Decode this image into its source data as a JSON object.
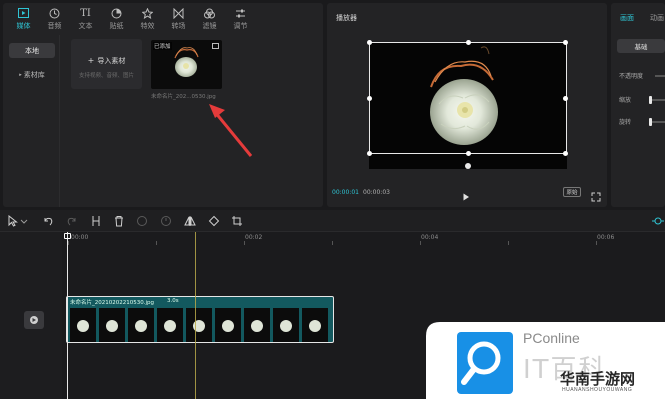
{
  "media_panel": {
    "tabs": [
      {
        "label": "媒体",
        "icon": "media-icon"
      },
      {
        "label": "音频",
        "icon": "audio-icon"
      },
      {
        "label": "文本",
        "icon": "text-icon"
      },
      {
        "label": "贴纸",
        "icon": "sticker-icon"
      },
      {
        "label": "特效",
        "icon": "effects-icon"
      },
      {
        "label": "转场",
        "icon": "transition-icon"
      },
      {
        "label": "滤镜",
        "icon": "filter-icon"
      },
      {
        "label": "调节",
        "icon": "adjust-icon"
      }
    ],
    "side": {
      "local": "本地",
      "library": "素材库"
    },
    "import": {
      "label": "导入素材",
      "hint": "支持视频、音频、图片"
    },
    "item": {
      "tag": "已添加",
      "filename": "未命名片_202...0530.jpg"
    }
  },
  "player": {
    "title": "播放器",
    "time_current": "00:00:01",
    "time_total": "00:00:03",
    "ratio": "原始"
  },
  "props": {
    "tab_screen": "画面",
    "tab_anim": "动画",
    "basic": "基础",
    "opacity": "不透明度",
    "scale": "缩放",
    "rotate": "旋转"
  },
  "timeline": {
    "ruler": [
      "00:00",
      "00:02",
      "00:04",
      "00:06"
    ],
    "clip": {
      "name": "未命名片_20210202210530.jpg",
      "duration": "3.0s"
    }
  },
  "watermark": {
    "brand": "PConline",
    "sub": "IT百科",
    "site": "华南手游网",
    "site_url": "HUANANSHOUYOUWANG"
  },
  "colors": {
    "accent": "#2fc4d4",
    "clip": "#13595f",
    "arrow": "#e53b3b"
  }
}
